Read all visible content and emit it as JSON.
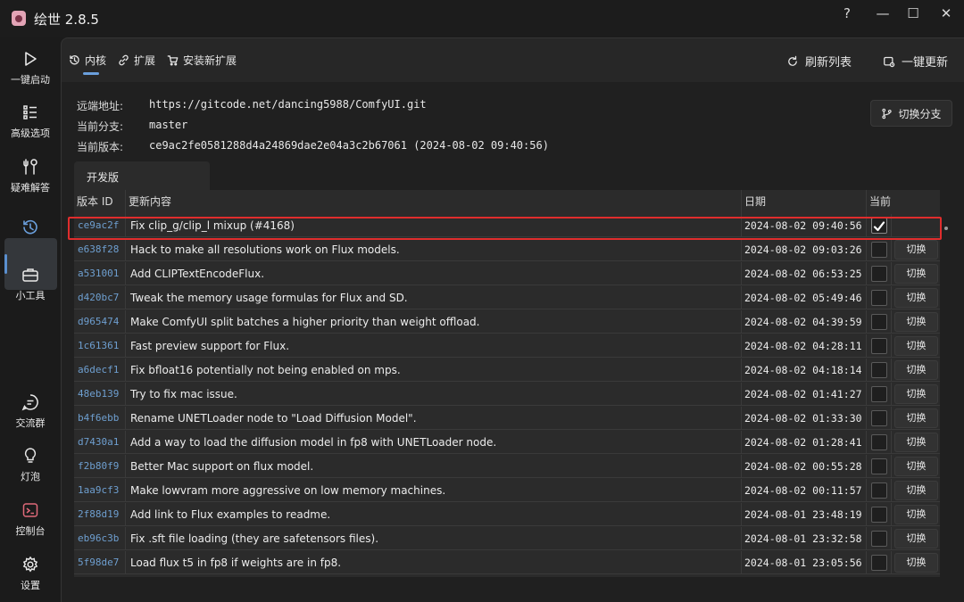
{
  "app": {
    "title": "绘世 2.8.5"
  },
  "window_controls": {
    "help": "?",
    "minimize": "—",
    "maximize": "☐",
    "close": "✕"
  },
  "sidebar": {
    "items": [
      {
        "label": "一键启动",
        "icon": "play-icon"
      },
      {
        "label": "高级选项",
        "icon": "list-icon"
      },
      {
        "label": "疑难解答",
        "icon": "tools-icon"
      },
      {
        "label": "",
        "icon": "history-icon"
      },
      {
        "label": "小工具",
        "icon": "toolbox-icon"
      },
      {
        "label": "交流群",
        "icon": "chat-icon"
      },
      {
        "label": "灯泡",
        "icon": "bulb-icon"
      },
      {
        "label": "控制台",
        "icon": "console-icon"
      },
      {
        "label": "设置",
        "icon": "gear-icon"
      }
    ],
    "active_index": 3
  },
  "tabs": [
    {
      "label": "内核",
      "icon": "history-icon",
      "active": true
    },
    {
      "label": "扩展",
      "icon": "link-icon"
    },
    {
      "label": "安装新扩展",
      "icon": "cart-icon"
    }
  ],
  "actions": {
    "refresh": "刷新列表",
    "update_all": "一键更新"
  },
  "info": {
    "remote_label": "远端地址:",
    "remote_value": "https://gitcode.net/dancing5988/ComfyUI.git",
    "branch_label": "当前分支:",
    "branch_value": "master",
    "version_label": "当前版本:",
    "version_value": "ce9ac2fe0581288d4a24869dae2e04a3c2b67061 (2024-08-02 09:40:56)",
    "switch_branch": "切换分支"
  },
  "branch_tab": "开发版",
  "table": {
    "headers": {
      "id": "版本 ID",
      "message": "更新内容",
      "date": "日期",
      "current": "当前"
    },
    "switch_label": "切换",
    "rows": [
      {
        "id": "ce9ac2f",
        "message": "Fix clip_g/clip_l mixup (#4168)",
        "date": "2024-08-02 09:40:56",
        "current": true
      },
      {
        "id": "e638f28",
        "message": "Hack to make all resolutions work on Flux models.",
        "date": "2024-08-02 09:03:26",
        "current": false
      },
      {
        "id": "a531001",
        "message": "Add CLIPTextEncodeFlux.",
        "date": "2024-08-02 06:53:25",
        "current": false
      },
      {
        "id": "d420bc7",
        "message": "Tweak the memory usage formulas for Flux and SD.",
        "date": "2024-08-02 05:49:46",
        "current": false
      },
      {
        "id": "d965474",
        "message": "Make ComfyUI split batches a higher priority than weight offload.",
        "date": "2024-08-02 04:39:59",
        "current": false
      },
      {
        "id": "1c61361",
        "message": "Fast preview support for Flux.",
        "date": "2024-08-02 04:28:11",
        "current": false
      },
      {
        "id": "a6decf1",
        "message": "Fix bfloat16 potentially not being enabled on mps.",
        "date": "2024-08-02 04:18:14",
        "current": false
      },
      {
        "id": "48eb139",
        "message": "Try to fix mac issue.",
        "date": "2024-08-02 01:41:27",
        "current": false
      },
      {
        "id": "b4f6ebb",
        "message": "Rename UNETLoader node to \"Load Diffusion Model\".",
        "date": "2024-08-02 01:33:30",
        "current": false
      },
      {
        "id": "d7430a1",
        "message": "Add a way to load the diffusion model in fp8 with UNETLoader node.",
        "date": "2024-08-02 01:28:41",
        "current": false
      },
      {
        "id": "f2b80f9",
        "message": "Better Mac support on flux model.",
        "date": "2024-08-02 00:55:28",
        "current": false
      },
      {
        "id": "1aa9cf3",
        "message": "Make lowvram more aggressive on low memory machines.",
        "date": "2024-08-02 00:11:57",
        "current": false
      },
      {
        "id": "2f88d19",
        "message": "Add link to Flux examples to readme.",
        "date": "2024-08-01 23:48:19",
        "current": false
      },
      {
        "id": "eb96c3b",
        "message": "Fix .sft file loading (they are safetensors files).",
        "date": "2024-08-01 23:32:58",
        "current": false
      },
      {
        "id": "5f98de7",
        "message": "Load flux t5 in fp8 if weights are in fp8.",
        "date": "2024-08-01 23:05:56",
        "current": false
      }
    ]
  },
  "colors": {
    "accent": "#6a9fdc",
    "highlight_border": "#e02d2d",
    "commit_id": "#6e9fd0"
  }
}
